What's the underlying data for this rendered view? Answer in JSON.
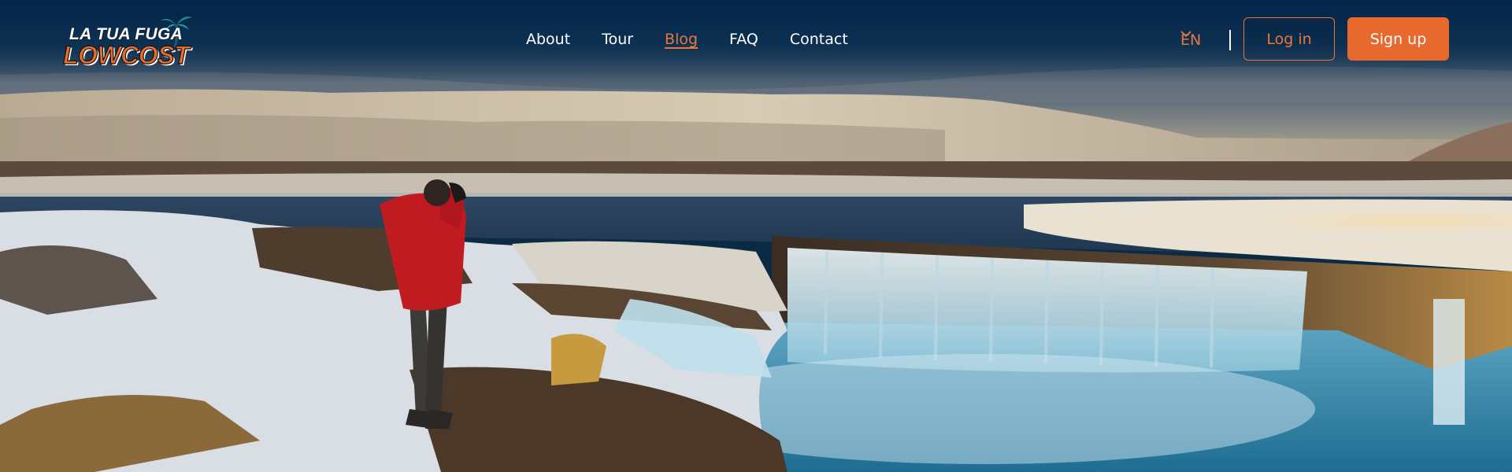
{
  "brand": {
    "line1": "LA TUA FUGA",
    "line2": "LOWCOST",
    "accent_color": "#e8692e",
    "icon": "palm-tree-icon"
  },
  "nav": {
    "items": [
      {
        "label": "About",
        "active": false
      },
      {
        "label": "Tour",
        "active": false
      },
      {
        "label": "Blog",
        "active": true
      },
      {
        "label": "FAQ",
        "active": false
      },
      {
        "label": "Contact",
        "active": false
      }
    ]
  },
  "language": {
    "selected": "EN",
    "icon": "chevron-down-icon"
  },
  "auth": {
    "login_label": "Log in",
    "signup_label": "Sign up"
  },
  "hero": {
    "image_subject": "photographer-at-waterfall"
  }
}
